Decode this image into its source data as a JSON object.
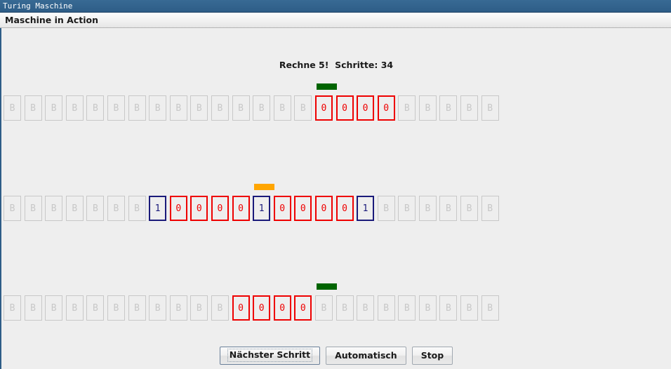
{
  "window": {
    "title": "Turing Maschine"
  },
  "menubar": {
    "label": "Maschine in Action"
  },
  "status": {
    "text": "Rechne 5!  Schritte: 34"
  },
  "colors": {
    "titlebar": "#31628c",
    "head_green": "#006400",
    "head_orange": "#ffa500",
    "cell_red": "#ee0000",
    "cell_blue": "#1a1a7a",
    "cell_blank": "#c8c8c8",
    "background": "#eeeeee"
  },
  "tapes": [
    {
      "name": "tape-1",
      "head_index": 15,
      "head_color": "green",
      "cells": [
        {
          "value": "B",
          "style": "blank"
        },
        {
          "value": "B",
          "style": "blank"
        },
        {
          "value": "B",
          "style": "blank"
        },
        {
          "value": "B",
          "style": "blank"
        },
        {
          "value": "B",
          "style": "blank"
        },
        {
          "value": "B",
          "style": "blank"
        },
        {
          "value": "B",
          "style": "blank"
        },
        {
          "value": "B",
          "style": "blank"
        },
        {
          "value": "B",
          "style": "blank"
        },
        {
          "value": "B",
          "style": "blank"
        },
        {
          "value": "B",
          "style": "blank"
        },
        {
          "value": "B",
          "style": "blank"
        },
        {
          "value": "B",
          "style": "blank"
        },
        {
          "value": "B",
          "style": "blank"
        },
        {
          "value": "B",
          "style": "blank"
        },
        {
          "value": "0",
          "style": "red"
        },
        {
          "value": "0",
          "style": "red"
        },
        {
          "value": "0",
          "style": "red"
        },
        {
          "value": "0",
          "style": "red"
        },
        {
          "value": "B",
          "style": "blank"
        },
        {
          "value": "B",
          "style": "blank"
        },
        {
          "value": "B",
          "style": "blank"
        },
        {
          "value": "B",
          "style": "blank"
        },
        {
          "value": "B",
          "style": "blank"
        }
      ]
    },
    {
      "name": "tape-2",
      "head_index": 12,
      "head_color": "orange",
      "cells": [
        {
          "value": "B",
          "style": "blank"
        },
        {
          "value": "B",
          "style": "blank"
        },
        {
          "value": "B",
          "style": "blank"
        },
        {
          "value": "B",
          "style": "blank"
        },
        {
          "value": "B",
          "style": "blank"
        },
        {
          "value": "B",
          "style": "blank"
        },
        {
          "value": "B",
          "style": "blank"
        },
        {
          "value": "1",
          "style": "blue"
        },
        {
          "value": "0",
          "style": "red"
        },
        {
          "value": "0",
          "style": "red"
        },
        {
          "value": "0",
          "style": "red"
        },
        {
          "value": "0",
          "style": "red"
        },
        {
          "value": "1",
          "style": "blue"
        },
        {
          "value": "0",
          "style": "red"
        },
        {
          "value": "0",
          "style": "red"
        },
        {
          "value": "0",
          "style": "red"
        },
        {
          "value": "0",
          "style": "red"
        },
        {
          "value": "1",
          "style": "blue"
        },
        {
          "value": "B",
          "style": "blank"
        },
        {
          "value": "B",
          "style": "blank"
        },
        {
          "value": "B",
          "style": "blank"
        },
        {
          "value": "B",
          "style": "blank"
        },
        {
          "value": "B",
          "style": "blank"
        },
        {
          "value": "B",
          "style": "blank"
        }
      ]
    },
    {
      "name": "tape-3",
      "head_index": 15,
      "head_color": "green",
      "cells": [
        {
          "value": "B",
          "style": "blank"
        },
        {
          "value": "B",
          "style": "blank"
        },
        {
          "value": "B",
          "style": "blank"
        },
        {
          "value": "B",
          "style": "blank"
        },
        {
          "value": "B",
          "style": "blank"
        },
        {
          "value": "B",
          "style": "blank"
        },
        {
          "value": "B",
          "style": "blank"
        },
        {
          "value": "B",
          "style": "blank"
        },
        {
          "value": "B",
          "style": "blank"
        },
        {
          "value": "B",
          "style": "blank"
        },
        {
          "value": "B",
          "style": "blank"
        },
        {
          "value": "0",
          "style": "red"
        },
        {
          "value": "0",
          "style": "red"
        },
        {
          "value": "0",
          "style": "red"
        },
        {
          "value": "0",
          "style": "red"
        },
        {
          "value": "B",
          "style": "blank"
        },
        {
          "value": "B",
          "style": "blank"
        },
        {
          "value": "B",
          "style": "blank"
        },
        {
          "value": "B",
          "style": "blank"
        },
        {
          "value": "B",
          "style": "blank"
        },
        {
          "value": "B",
          "style": "blank"
        },
        {
          "value": "B",
          "style": "blank"
        },
        {
          "value": "B",
          "style": "blank"
        },
        {
          "value": "B",
          "style": "blank"
        }
      ]
    }
  ],
  "buttons": [
    {
      "name": "next-step-button",
      "label": "Nächster Schritt",
      "focused": true
    },
    {
      "name": "automatic-button",
      "label": "Automatisch",
      "focused": false
    },
    {
      "name": "stop-button",
      "label": "Stop",
      "focused": false
    }
  ]
}
